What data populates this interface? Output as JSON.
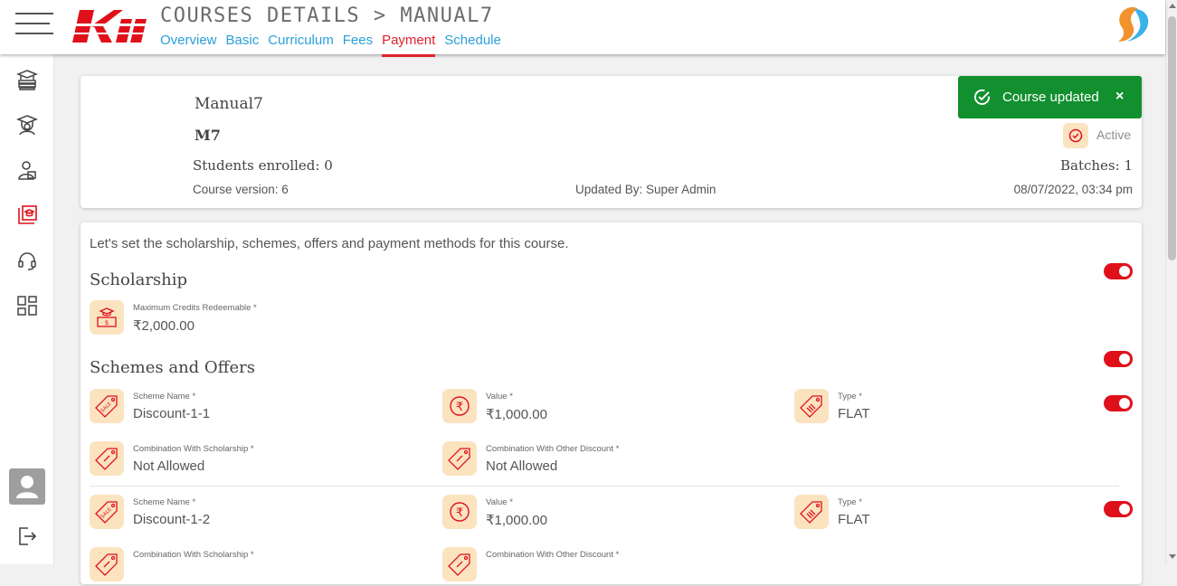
{
  "header": {
    "title": "COURSES DETAILS > MANUAL7",
    "tabs": [
      {
        "label": "Overview",
        "active": false
      },
      {
        "label": "Basic",
        "active": false
      },
      {
        "label": "Curriculum",
        "active": false
      },
      {
        "label": "Fees",
        "active": false
      },
      {
        "label": "Payment",
        "active": true
      },
      {
        "label": "Schedule",
        "active": false
      }
    ],
    "logo_text": "Kii"
  },
  "sidebar": {
    "items": [
      {
        "icon": "books-icon"
      },
      {
        "icon": "graduate-icon"
      },
      {
        "icon": "user-card-icon"
      },
      {
        "icon": "course-book-icon",
        "active": true
      },
      {
        "icon": "headset-icon"
      },
      {
        "icon": "grid-icon"
      }
    ]
  },
  "course": {
    "name": "Manual7",
    "code": "M7",
    "students_enrolled": "Students enrolled: 0",
    "batches": "Batches: 1",
    "version": "Course version: 6",
    "updated_by": "Updated By: Super Admin",
    "updated_at": "08/07/2022, 03:34 pm",
    "status": "Active"
  },
  "toast": {
    "message": "Course updated",
    "close": "×"
  },
  "payment": {
    "intro": "Let's set the scholarship, schemes, offers and payment methods for this course.",
    "scholarship": {
      "title": "Scholarship",
      "enabled": true,
      "max_credits_label": "Maximum Credits Redeemable *",
      "max_credits_value": "₹2,000.00"
    },
    "schemes": {
      "title": "Schemes and Offers",
      "enabled": true,
      "items": [
        {
          "scheme_name_label": "Scheme Name *",
          "scheme_name": "Discount-1-1",
          "value_label": "Value *",
          "value": "₹1,000.00",
          "type_label": "Type *",
          "type": "FLAT",
          "combo_scholarship_label": "Combination With Scholarship *",
          "combo_scholarship": "Not Allowed",
          "combo_other_label": "Combination With Other Discount *",
          "combo_other": "Not Allowed",
          "enabled": true
        },
        {
          "scheme_name_label": "Scheme Name *",
          "scheme_name": "Discount-1-2",
          "value_label": "Value *",
          "value": "₹1,000.00",
          "type_label": "Type *",
          "type": "FLAT",
          "combo_scholarship_label": "Combination With Scholarship *",
          "combo_other_label": "Combination With Other Discount *",
          "enabled": true
        }
      ]
    }
  },
  "colors": {
    "accent": "#e0222b",
    "link": "#2a9fd8",
    "success": "#12902f",
    "icon_bg": "#fbe3c0"
  }
}
